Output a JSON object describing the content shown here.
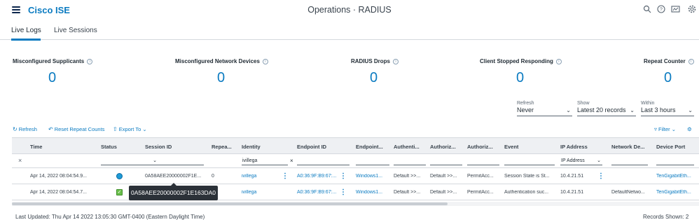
{
  "header": {
    "brand": "Cisco ISE",
    "title": "Operations · RADIUS",
    "icons": [
      "search-icon",
      "help-icon",
      "dashboard-icon",
      "gear-icon"
    ]
  },
  "tabs": [
    {
      "label": "Live Logs",
      "active": true
    },
    {
      "label": "Live Sessions",
      "active": false
    }
  ],
  "counters": [
    {
      "label": "Misconfigured Supplicants",
      "value": "0"
    },
    {
      "label": "Misconfigured Network Devices",
      "value": "0"
    },
    {
      "label": "RADIUS Drops",
      "value": "0"
    },
    {
      "label": "Client Stopped Responding",
      "value": "0"
    },
    {
      "label": "Repeat Counter",
      "value": "0"
    }
  ],
  "filters": {
    "refresh": {
      "label": "Refresh",
      "value": "Never"
    },
    "show": {
      "label": "Show",
      "value": "Latest 20 records"
    },
    "within": {
      "label": "Within",
      "value": "Last 3 hours"
    }
  },
  "toolbar": {
    "refresh": "Refresh",
    "reset": "Reset Repeat Counts",
    "export": "Export To",
    "filter": "Filter"
  },
  "table": {
    "headers": [
      "Time",
      "Status",
      "Session ID",
      "Repea...",
      "Identity",
      "Endpoint ID",
      "Endpoint...",
      "Authenti...",
      "Authoriz...",
      "Authoriz...",
      "Event",
      "IP Address",
      "Network De...",
      "Device Port"
    ],
    "filter_row": {
      "identity": "ivillega",
      "ip_address": "IP Address"
    },
    "rows": [
      {
        "time": "Apr 14, 2022 08:04:54.9...",
        "status": "session",
        "session_id": "0A58AEE20000002F1E...",
        "repeat": "0",
        "identity": "ivillega",
        "endpoint_id": "A0:36:9F:B9:67:...",
        "endpoint_profile": "Windows1...",
        "authentication": "Default >>...",
        "authorization_rule": "Default >>...",
        "authorization_profile": "PermitAcc...",
        "event": "Session State is St...",
        "ip_address": "10.4.21.51",
        "network_device": "",
        "device_port": "TenGigabitEth..."
      },
      {
        "time": "Apr 14, 2022 08:04:54.7...",
        "status": "success",
        "session_id": "",
        "repeat": "",
        "identity": "ivillega",
        "endpoint_id": "A0:36:9F:B9:67:...",
        "endpoint_profile": "Windows1...",
        "authentication": "Default >>...",
        "authorization_rule": "Default >>...",
        "authorization_profile": "PermitAcc...",
        "event": "Authentication suc...",
        "ip_address": "10.4.21.51",
        "network_device": "DefaultNetwo...",
        "device_port": "TenGigabitEth..."
      }
    ],
    "tooltip": "0A58AEE20000002F1E163DA0"
  },
  "footer": {
    "last_updated": "Last Updated: Thu Apr 14 2022 13:05:30 GMT-0400 (Eastern Daylight Time)",
    "records_shown": "Records Shown: 2"
  },
  "colors": {
    "accent": "#0b7bc1",
    "session_icon": "#1e9bd7",
    "success_icon": "#6abf4b",
    "tooltip_bg": "#2b3138"
  }
}
